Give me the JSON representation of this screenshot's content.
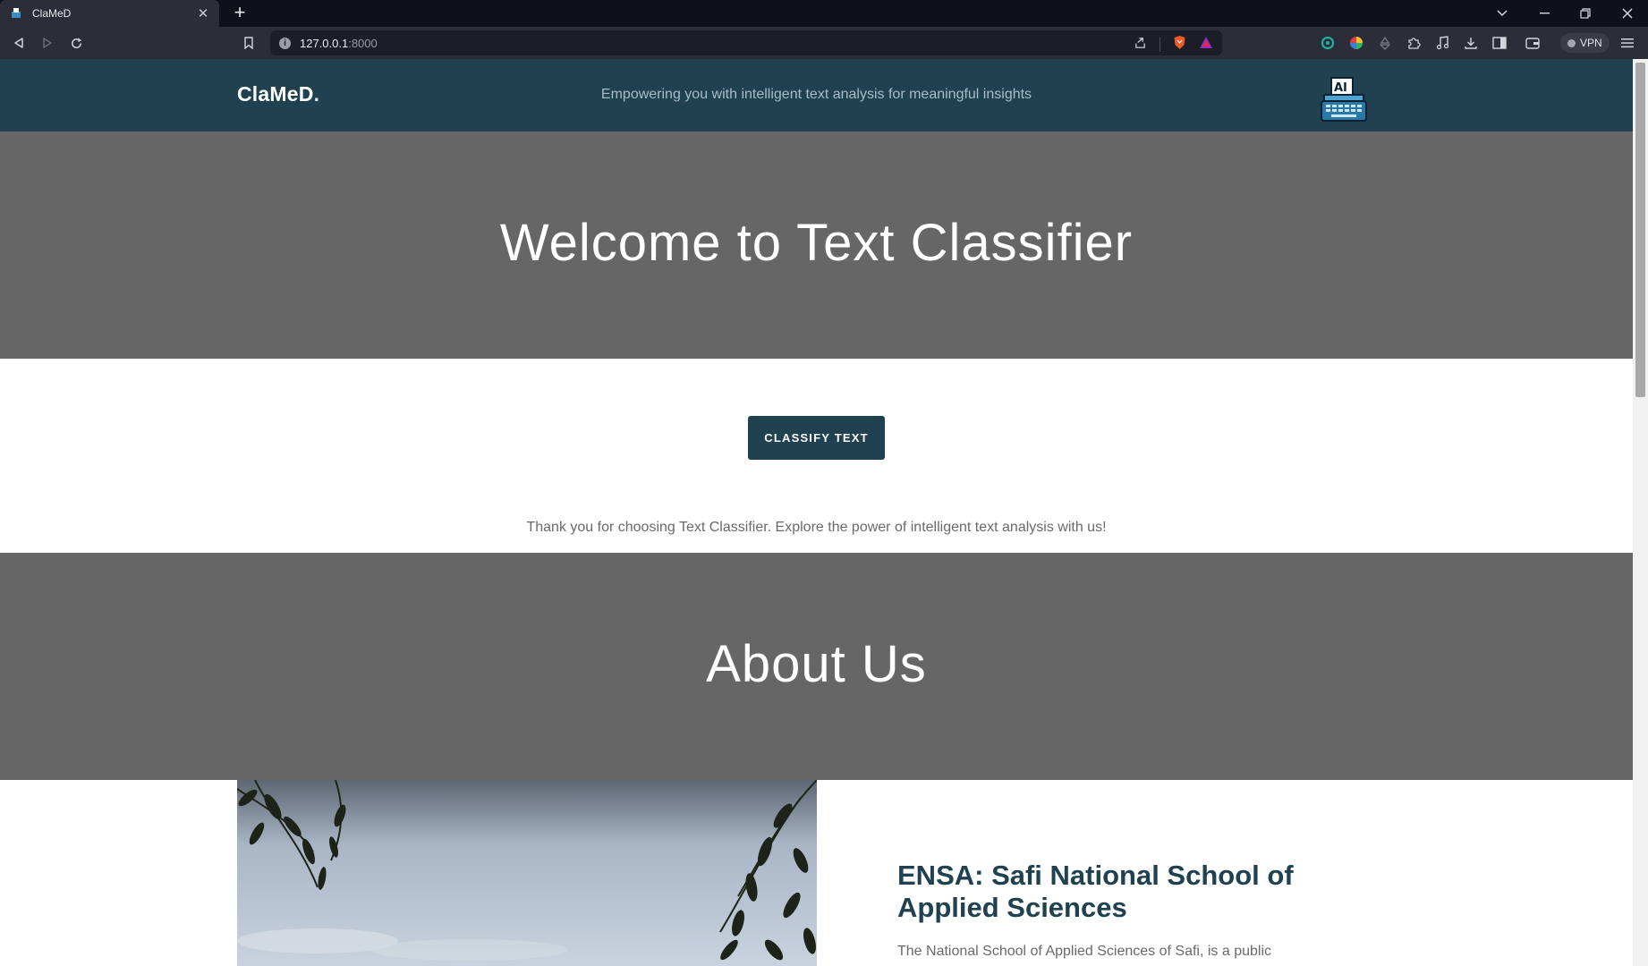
{
  "browser": {
    "tab_title": "ClaMeD",
    "url_host": "127.0.0.1",
    "url_port": ":8000",
    "vpn_label": "VPN"
  },
  "site": {
    "brand": "ClaMeD",
    "brand_dot": ".",
    "tagline": "Empowering you with intelligent text analysis for meaningful insights",
    "logo_text": "AI"
  },
  "hero": {
    "heading": "Welcome to Text Classifier"
  },
  "cta": {
    "label": "CLASSIFY TEXT"
  },
  "intro": {
    "thanks": "Thank you for choosing Text Classifier. Explore the power of intelligent text analysis with us!"
  },
  "about": {
    "heading": "About Us",
    "school_title": "ENSA: Safi National School of Applied Sciences",
    "school_desc": "The National School of Applied Sciences of Safi, is a public"
  },
  "colors": {
    "header_bg": "#1f4150",
    "section_bg": "#666666",
    "accent": "#1f4150"
  }
}
